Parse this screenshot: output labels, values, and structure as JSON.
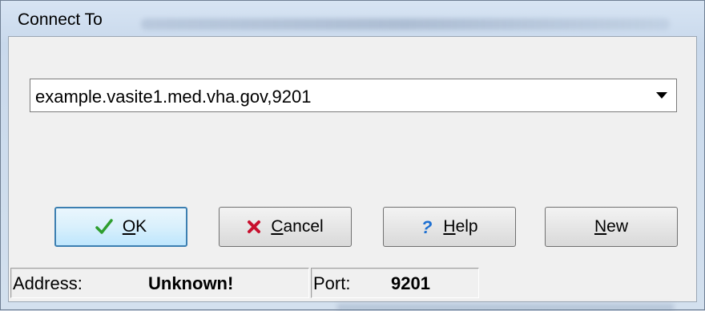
{
  "window": {
    "title": "Connect To"
  },
  "server_combo": {
    "value": "example.vasite1.med.vha.gov,9201"
  },
  "buttons": {
    "ok": {
      "mnemonic": "O",
      "rest": "K"
    },
    "cancel": {
      "mnemonic": "C",
      "rest": "ancel"
    },
    "help": {
      "mnemonic": "H",
      "rest": "elp"
    },
    "new": {
      "mnemonic": "N",
      "rest": "ew"
    }
  },
  "status": {
    "address_label": "Address:",
    "address_value": "Unknown!",
    "port_label": "Port:",
    "port_value": "9201"
  },
  "icons": {
    "ok": "checkmark-icon",
    "cancel": "red-x-icon",
    "help": "question-mark-icon",
    "dropdown": "dropdown-arrow-icon"
  },
  "colors": {
    "checkmark": "#2e9e2e",
    "cancel_x": "#c8102e",
    "help_q": "#1d6fd1",
    "default_button_border": "#3c7fb1"
  }
}
